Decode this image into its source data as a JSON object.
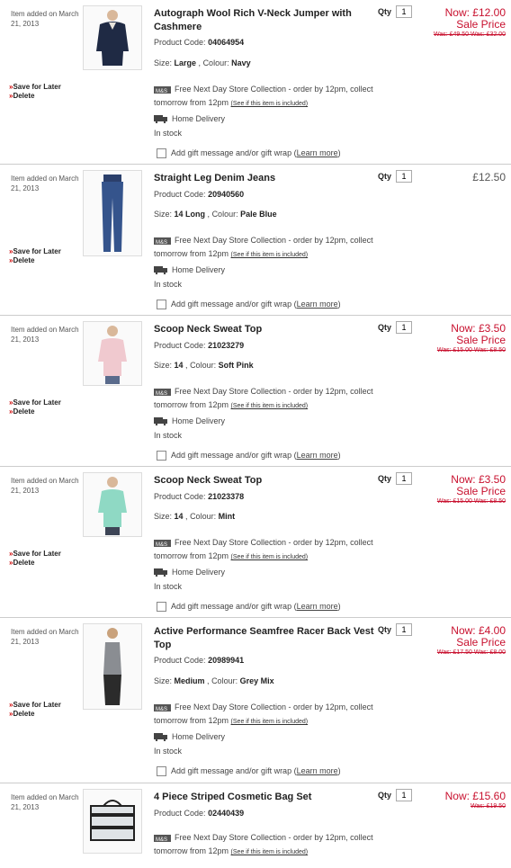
{
  "common": {
    "added": "Item added on March 21, 2013",
    "save_for_later": "Save for Later",
    "delete": "Delete",
    "product_code_label": "Product Code:",
    "size_label": "Size:",
    "colour_label": "Colour:",
    "qty_label": "Qty",
    "store_collection": "Free Next Day Store Collection - order by 12pm, collect tomorrow from 12pm",
    "see_if_included": "(See if this item is included)",
    "home_delivery": "Home Delivery",
    "in_stock": "In stock",
    "gift_text": "Add gift message and/or gift wrap",
    "learn_more": "Learn more",
    "now_label": "Now:",
    "sale_label": "Sale Price"
  },
  "items": [
    {
      "title": "Autograph Wool Rich V-Neck Jumper with Cashmere",
      "code": "04064954",
      "size": "Large",
      "colour": "Navy",
      "qty": "1",
      "now_price": "£12.00",
      "was_text": "Was: £49.50 Was: £32.00"
    },
    {
      "title": "Straight Leg Denim Jeans",
      "code": "20940560",
      "size": "14 Long",
      "colour": "Pale Blue",
      "qty": "1",
      "price": "£12.50"
    },
    {
      "title": "Scoop Neck Sweat Top",
      "code": "21023279",
      "size": "14",
      "colour": "Soft Pink",
      "qty": "1",
      "now_price": "£3.50",
      "was_text": "Was: £15.00 Was: £8.50"
    },
    {
      "title": "Scoop Neck Sweat Top",
      "code": "21023378",
      "size": "14",
      "colour": "Mint",
      "qty": "1",
      "now_price": "£3.50",
      "was_text": "Was: £15.00 Was: £8.50"
    },
    {
      "title": "Active Performance Seamfree Racer Back Vest Top",
      "code": "20989941",
      "size": "Medium",
      "colour": "Grey Mix",
      "qty": "1",
      "now_price": "£4.00",
      "was_text": "Was: £17.50 Was: £8.00"
    },
    {
      "title": "4 Piece Striped Cosmetic Bag Set",
      "code": "02440439",
      "qty": "1",
      "now_price": "£15.60",
      "was_text": "Was: £19.50"
    }
  ]
}
